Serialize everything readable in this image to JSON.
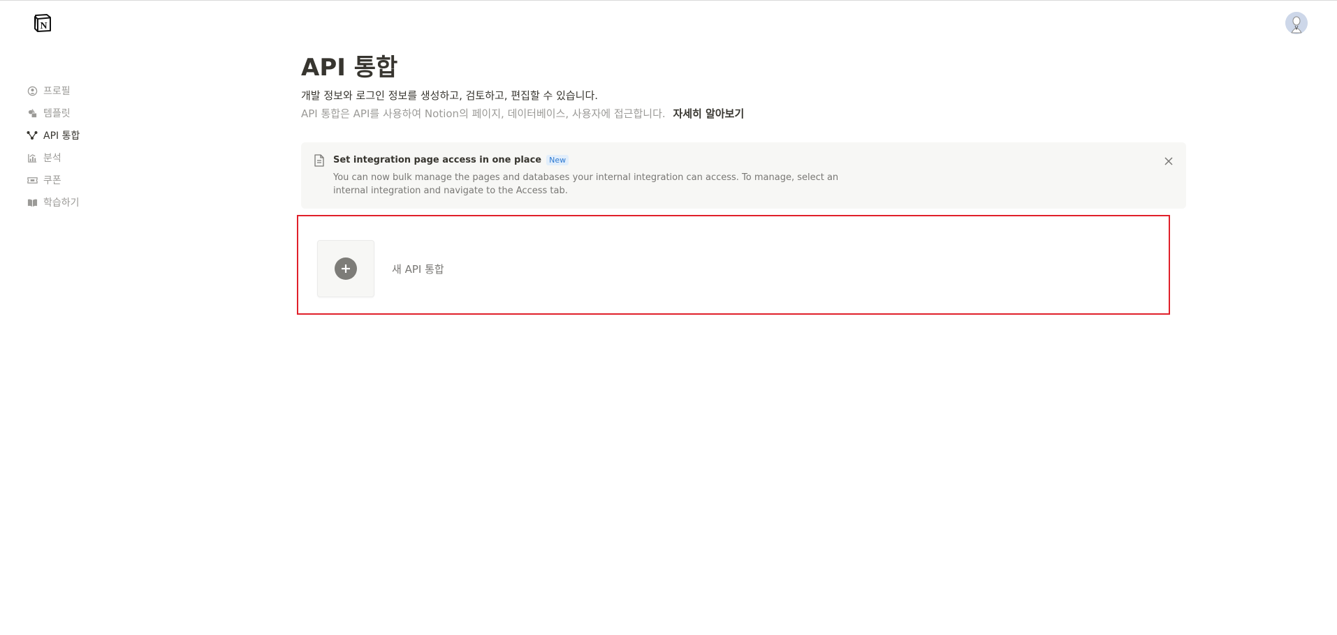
{
  "header": {
    "logo": "notion-logo-icon",
    "avatar": "user-avatar"
  },
  "sidebar": {
    "items": [
      {
        "label": "프로필",
        "icon": "profile-icon",
        "active": false
      },
      {
        "label": "템플릿",
        "icon": "shapes-icon",
        "active": false
      },
      {
        "label": "API 통합",
        "icon": "integration-icon",
        "active": true
      },
      {
        "label": "분석",
        "icon": "analytics-icon",
        "active": false
      },
      {
        "label": "쿠폰",
        "icon": "ticket-icon",
        "active": false
      },
      {
        "label": "학습하기",
        "icon": "book-icon",
        "active": false
      }
    ]
  },
  "main": {
    "title": "API 통합",
    "subtitle": "개발 정보와 로그인 정보를 생성하고, 검토하고, 편집할 수 있습니다.",
    "description": "API 통합은 API를 사용하여 Notion의 페이지, 데이터베이스, 사용자에 접근합니다.",
    "learn_more": "자세히 알아보기"
  },
  "banner": {
    "title": "Set integration page access in one place",
    "badge": "New",
    "body": "You can now bulk manage the pages and databases your internal integration can access. To manage, select an internal integration and navigate to the Access tab."
  },
  "new_integration": {
    "label": "새 API 통합"
  },
  "colors": {
    "accent_badge_bg": "#e2eefb",
    "accent_badge_text": "#2e7ad1",
    "highlight_border": "#e0202a"
  }
}
